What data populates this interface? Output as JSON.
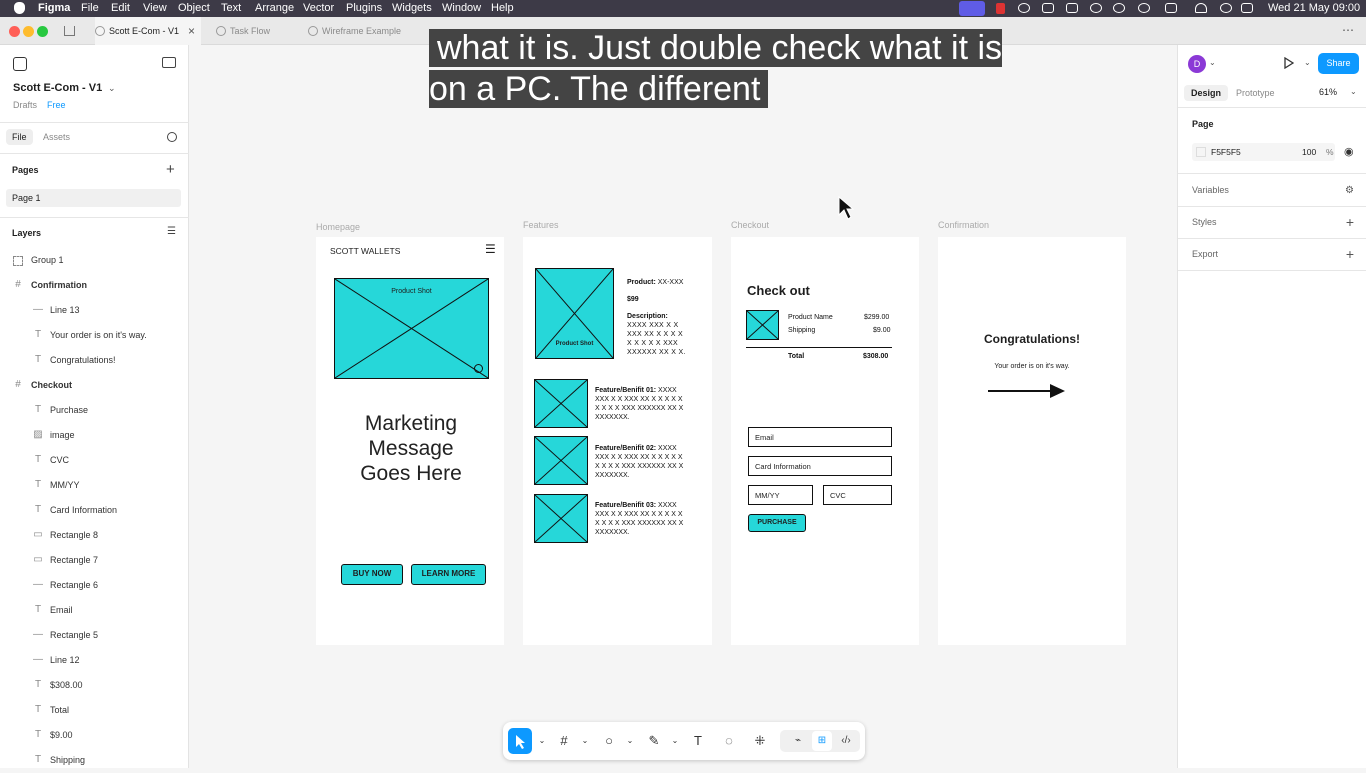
{
  "menubar": {
    "app": "Figma",
    "items": [
      "File",
      "Edit",
      "View",
      "Object",
      "Text",
      "Arrange",
      "Vector",
      "Plugins",
      "Widgets",
      "Window",
      "Help"
    ],
    "clock": "Wed 21 May  09:00"
  },
  "tabs": [
    {
      "label": "Scott E-Com - V1"
    },
    {
      "label": "Task Flow"
    },
    {
      "label": "Wireframe Example"
    }
  ],
  "left": {
    "project": "Scott E-Com - V1",
    "drafts": "Drafts",
    "plan": "Free",
    "file_tab": "File",
    "assets_tab": "Assets",
    "pages_header": "Pages",
    "page": "Page 1",
    "layers_header": "Layers",
    "layers": [
      "Group 1",
      "Confirmation",
      "Line 13",
      "Your order is on it's way.",
      "Congratulations!",
      "Checkout",
      "Purchase",
      "image",
      "CVC",
      "MM/YY",
      "Card Information",
      "Rectangle 8",
      "Rectangle 7",
      "Rectangle 6",
      "Email",
      "Rectangle 5",
      "Line 12",
      "$308.00",
      "Total",
      "$9.00",
      "Shipping"
    ]
  },
  "caption": "what it is. Just double check what it is on a PC. The different",
  "frames": {
    "homepage": {
      "label": "Homepage",
      "brand": "SCOTT WALLETS",
      "product_shot": "Product Shot",
      "message": "Marketing Message Goes Here",
      "buy": "BUY NOW",
      "learn": "LEARN MORE"
    },
    "features": {
      "label": "Features",
      "product_shot": "Product Shot",
      "product_label": "Product:",
      "product_value": "XX-XXX",
      "price": "$99",
      "desc_label": "Description:",
      "desc_value": "XXXX XXX X X XXX XX X X X X X X X X X XXX XXXXXX XX X X.",
      "items": [
        {
          "title": "Feature/Benifit 01:",
          "text": "XXXX XXX X X XXX XX X X X X X X X X X XXX XXXXXX XX X XXXXXXX."
        },
        {
          "title": "Feature/Benifit 02:",
          "text": "XXXX XXX X X XXX XX X X X X X X X X X XXX XXXXXX XX X XXXXXXX."
        },
        {
          "title": "Feature/Benifit 03:",
          "text": "XXXX XXX X X XXX XX X X X X X X X X X XXX XXXXXX XX X XXXXXXX."
        }
      ]
    },
    "checkout": {
      "label": "Checkout",
      "title": "Check out",
      "product_name": "Product Name",
      "product_price": "$299.00",
      "shipping": "Shipping",
      "shipping_price": "$9.00",
      "total": "Total",
      "total_price": "$308.00",
      "email": "Email",
      "card": "Card Information",
      "mmyy": "MM/YY",
      "cvc": "CVC",
      "purchase": "PURCHASE"
    },
    "confirmation": {
      "label": "Confirmation",
      "title": "Congratulations!",
      "sub": "Your order is on it's way."
    }
  },
  "right": {
    "avatar": "D",
    "share": "Share",
    "design_tab": "Design",
    "prototype_tab": "Prototype",
    "zoom": "61%",
    "page_header": "Page",
    "page_color": "F5F5F5",
    "opacity": "100",
    "opacity_unit": "%",
    "variables": "Variables",
    "styles": "Styles",
    "export": "Export"
  },
  "colors": {
    "accent": "#26d7d9",
    "share": "#0d99ff",
    "menubar": "#3d3a47"
  }
}
